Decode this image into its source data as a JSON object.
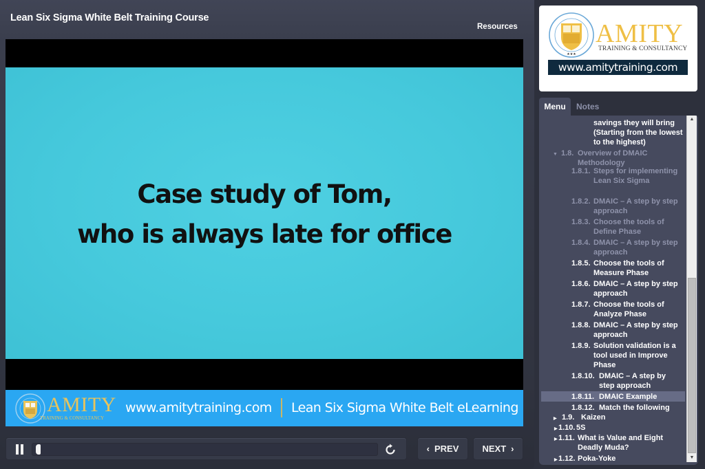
{
  "header": {
    "course_title": "Lean Six Sigma White Belt Training Course",
    "resources_label": "Resources"
  },
  "slide": {
    "line1": "Case study of Tom,",
    "line2": "who is always late for office",
    "background_color": "#46c9dc"
  },
  "banner": {
    "brand": "AMITY",
    "brand_sub": "TRAINING & CONSULTANCY",
    "url": "www.amitytraining.com",
    "course": "Lean Six Sigma White Belt eLearning",
    "background_color": "#2aa7f2"
  },
  "player": {
    "pause_label": "pause",
    "progress_fraction": 0.01,
    "replay_label": "replay",
    "prev_label": "PREV",
    "next_label": "NEXT",
    "prev_chevron": "‹",
    "next_chevron": "›"
  },
  "logo": {
    "brand": "AMITY",
    "brand_sub": "TRAINING & CONSULTANCY",
    "url": "www.amitytraining.com",
    "brand_color": "#efbf45"
  },
  "sidebar": {
    "tabs": [
      {
        "label": "Menu",
        "active": true
      },
      {
        "label": "Notes",
        "active": false
      }
    ],
    "menu_items": [
      {
        "num": "",
        "text": "savings they will bring (Starting from the lowest to the highest)",
        "state": "visited",
        "level": 3,
        "toggle": ""
      },
      {
        "num": "1.8.",
        "text": "Overview of DMAIC Methodology",
        "state": "dim",
        "level": 2,
        "toggle": "▼"
      },
      {
        "num": "1.8.1.",
        "text": "Steps for implementing Lean Six Sigma",
        "state": "dim",
        "level": 3,
        "toggle": ""
      },
      {
        "num": "1.8.2.",
        "text": "DMAIC – A step by step approach",
        "state": "dim",
        "level": 3,
        "toggle": ""
      },
      {
        "num": "1.8.3.",
        "text": "Choose the tools of Define Phase",
        "state": "dim",
        "level": 3,
        "toggle": ""
      },
      {
        "num": "1.8.4.",
        "text": "DMAIC – A step by step approach",
        "state": "dim",
        "level": 3,
        "toggle": ""
      },
      {
        "num": "1.8.5.",
        "text": "Choose the tools of Measure Phase",
        "state": "visited",
        "level": 3,
        "toggle": ""
      },
      {
        "num": "1.8.6.",
        "text": "DMAIC – A step by step approach",
        "state": "visited",
        "level": 3,
        "toggle": ""
      },
      {
        "num": "1.8.7.",
        "text": "Choose the tools of Analyze Phase",
        "state": "visited",
        "level": 3,
        "toggle": ""
      },
      {
        "num": "1.8.8.",
        "text": "DMAIC – A step by step approach",
        "state": "visited",
        "level": 3,
        "toggle": ""
      },
      {
        "num": "1.8.9.",
        "text": "Solution validation is a tool used in Improve Phase",
        "state": "visited",
        "level": 3,
        "toggle": ""
      },
      {
        "num": "1.8.10.",
        "text": "DMAIC – A step by step approach",
        "state": "visited",
        "level": 3,
        "toggle": ""
      },
      {
        "num": "1.8.11.",
        "text": "DMAIC Example",
        "state": "current",
        "level": 3,
        "toggle": ""
      },
      {
        "num": "1.8.12.",
        "text": "Match the following",
        "state": "visited",
        "level": 3,
        "toggle": ""
      },
      {
        "num": "1.9.",
        "text": "Kaizen",
        "state": "visited",
        "level": 2,
        "toggle": "▶"
      },
      {
        "num": "1.10.",
        "text": "5S",
        "state": "visited",
        "level": 2,
        "toggle": "▶"
      },
      {
        "num": "1.11.",
        "text": "What is Value and Eight Deadly Muda?",
        "state": "visited",
        "level": 2,
        "toggle": "▶"
      },
      {
        "num": "1.12.",
        "text": "Poka-Yoke",
        "state": "visited",
        "level": 2,
        "toggle": "▶"
      }
    ],
    "scroll_up": "▲",
    "scroll_down": "▼"
  }
}
